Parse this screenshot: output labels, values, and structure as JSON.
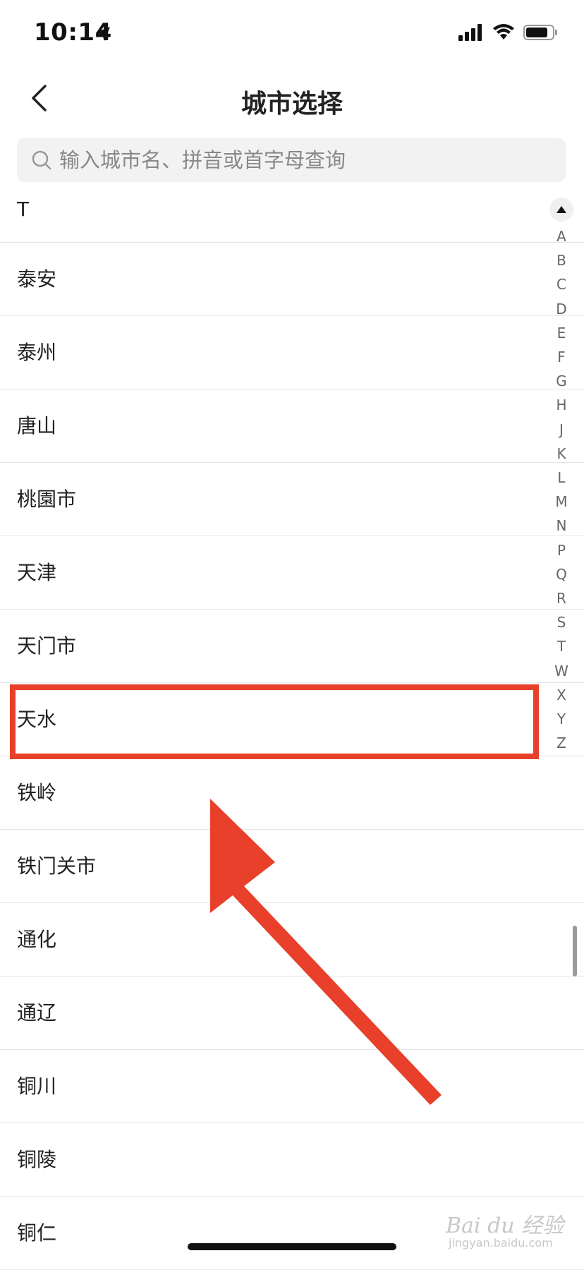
{
  "status_bar": {
    "time": "10:14"
  },
  "nav": {
    "title": "城市选择"
  },
  "search": {
    "placeholder": "输入城市名、拼音或首字母查询"
  },
  "section": {
    "letter": "T"
  },
  "cities": [
    "泰安",
    "泰州",
    "唐山",
    "桃園市",
    "天津",
    "天门市",
    "天水",
    "铁岭",
    "铁门关市",
    "通化",
    "通辽",
    "铜川",
    "铜陵",
    "铜仁"
  ],
  "index_letters": [
    "A",
    "B",
    "C",
    "D",
    "E",
    "F",
    "G",
    "H",
    "J",
    "K",
    "L",
    "M",
    "N",
    "P",
    "Q",
    "R",
    "S",
    "T",
    "W",
    "X",
    "Y",
    "Z"
  ],
  "highlighted_city": "天水",
  "annotation_color": "#e8402a",
  "watermark": {
    "main": "Bai du 经验",
    "sub": "jingyan.baidu.com"
  }
}
